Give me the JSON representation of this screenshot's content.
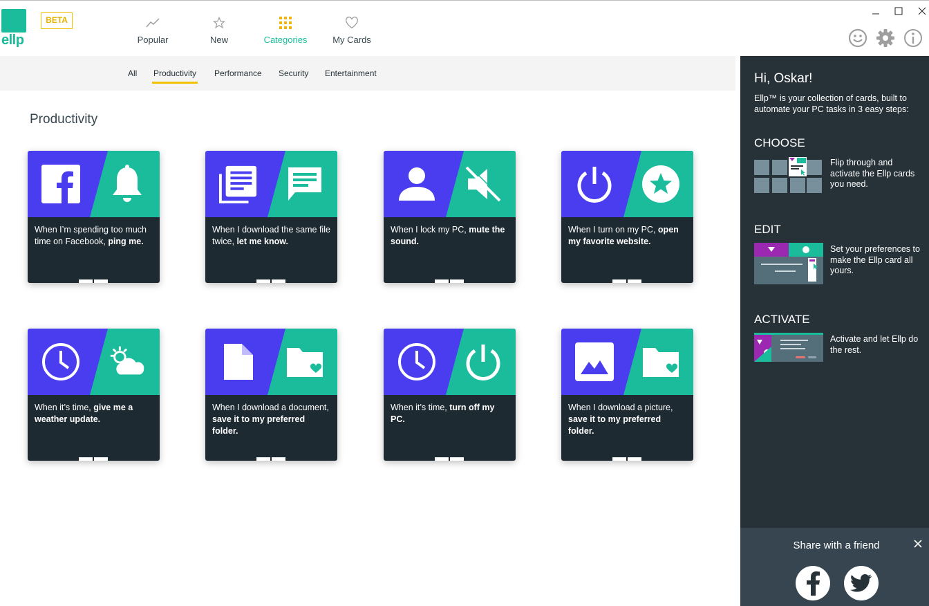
{
  "app": {
    "logo_text": "ellp",
    "beta_label": "BETA"
  },
  "nav": {
    "items": [
      {
        "label": "Popular",
        "icon": "trending-icon"
      },
      {
        "label": "New",
        "icon": "star-outline-icon"
      },
      {
        "label": "Categories",
        "icon": "grid-icon",
        "active": true
      },
      {
        "label": "My Cards",
        "icon": "heart-outline-icon"
      }
    ]
  },
  "categories": {
    "tabs": [
      "All",
      "Productivity",
      "Performance",
      "Security",
      "Entertainment"
    ],
    "active": "Productivity"
  },
  "section_title": "Productivity",
  "cards": [
    {
      "pre": "When I’m spending too much time on Facebook, ",
      "bold": "ping me.",
      "icon1": "facebook-icon",
      "icon2": "bell-icon"
    },
    {
      "pre": "When I download the same file twice, ",
      "bold": "let me know.",
      "icon1": "document-list-icon",
      "icon2": "chat-message-icon"
    },
    {
      "pre": "When I lock my PC, ",
      "bold": "mute the sound.",
      "icon1": "user-icon",
      "icon2": "volume-mute-icon"
    },
    {
      "pre": "When I turn on my PC, ",
      "bold": "open my favorite website.",
      "icon1": "power-icon",
      "icon2": "star-circle-icon"
    },
    {
      "pre": "When it’s time, ",
      "bold": "give me a weather update.",
      "icon1": "clock-icon",
      "icon2": "partly-cloudy-icon"
    },
    {
      "pre": "When I download a document, ",
      "bold": "save it to my preferred folder.",
      "icon1": "file-icon",
      "icon2": "folder-heart-icon"
    },
    {
      "pre": "When it’s time, ",
      "bold": "turn off my PC.",
      "icon1": "clock-icon",
      "icon2": "power-icon"
    },
    {
      "pre": "When I download a picture, ",
      "bold": "save it to my preferred folder.",
      "icon1": "image-icon",
      "icon2": "folder-heart-icon"
    }
  ],
  "panel": {
    "greeting": "Hi, Oskar!",
    "intro": "Ellp™ is your collection of cards, built to automate your PC tasks in 3 easy steps:",
    "steps": [
      {
        "title": "CHOOSE",
        "text": "Flip through and activate the Ellp cards you need."
      },
      {
        "title": "EDIT",
        "text": "Set your preferences to make the Ellp card all yours."
      },
      {
        "title": "ACTIVATE",
        "text": "Activate and let Ellp do the rest."
      }
    ],
    "share": {
      "title": "Share with a friend"
    }
  },
  "colors": {
    "accent": "#1abc9c",
    "card_purple": "#4a3df0",
    "card_teal": "#1abc9c",
    "card_dark": "#1e2a32",
    "panel_bg": "#263238",
    "beta_yellow": "#f2c200"
  }
}
